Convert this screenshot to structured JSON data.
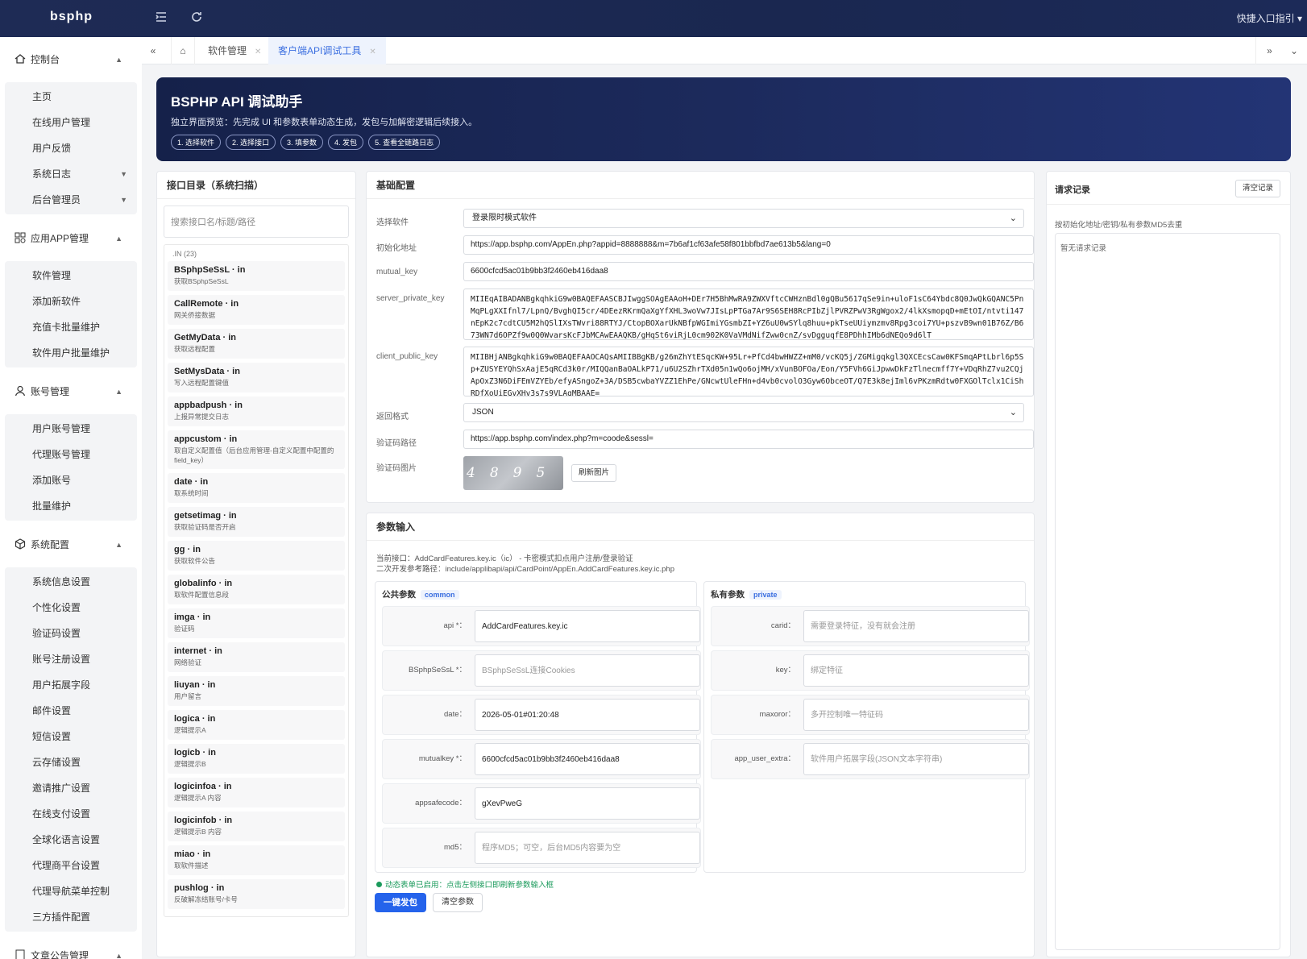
{
  "app": {
    "brand": "bsphp",
    "quick_guide": "快捷入口指引 ▾"
  },
  "sidebar": {
    "groups": [
      {
        "label": "控制台",
        "icon": "home-icon",
        "items": [
          {
            "label": "主页"
          },
          {
            "label": "在线用户管理"
          },
          {
            "label": "用户反馈"
          },
          {
            "label": "系统日志",
            "caret": true
          },
          {
            "label": "后台管理员",
            "caret": true
          }
        ]
      },
      {
        "label": "应用APP管理",
        "icon": "apps-icon",
        "items": [
          {
            "label": "软件管理"
          },
          {
            "label": "添加新软件"
          },
          {
            "label": "充值卡批量维护"
          },
          {
            "label": "软件用户批量维护"
          }
        ]
      },
      {
        "label": "账号管理",
        "icon": "user-icon",
        "items": [
          {
            "label": "用户账号管理"
          },
          {
            "label": "代理账号管理"
          },
          {
            "label": "添加账号"
          },
          {
            "label": "批量维护"
          }
        ]
      },
      {
        "label": "系统配置",
        "icon": "cube-icon",
        "items": [
          {
            "label": "系统信息设置"
          },
          {
            "label": "个性化设置"
          },
          {
            "label": "验证码设置"
          },
          {
            "label": "账号注册设置"
          },
          {
            "label": "用户拓展字段"
          },
          {
            "label": "邮件设置"
          },
          {
            "label": "短信设置"
          },
          {
            "label": "云存储设置"
          },
          {
            "label": "邀请推广设置"
          },
          {
            "label": "在线支付设置"
          },
          {
            "label": "全球化语言设置"
          },
          {
            "label": "代理商平台设置"
          },
          {
            "label": "代理导航菜单控制"
          },
          {
            "label": "三方插件配置"
          }
        ]
      },
      {
        "label": "文章公告管理",
        "icon": "doc-icon",
        "items": []
      }
    ]
  },
  "tabs": [
    {
      "label": "软件管理"
    },
    {
      "label": "客户端API调试工具"
    }
  ],
  "banner": {
    "title": "BSPHP API 调试助手",
    "subtitle": "独立界面预览：先完成 UI 和参数表单动态生成，发包与加解密逻辑后续接入。",
    "steps": [
      "1. 选择软件",
      "2. 选择接口",
      "3. 填参数",
      "4. 发包",
      "5. 查看全链路日志"
    ]
  },
  "directory": {
    "title": "接口目录（系统扫描）",
    "search_placeholder": "搜索接口名/标题/路径",
    "caption": ".IN (23)",
    "items": [
      {
        "name": "BSphpSeSsL · in",
        "desc": "获取BSphpSeSsL"
      },
      {
        "name": "CallRemote · in",
        "desc": "网关侨接数据"
      },
      {
        "name": "GetMyData · in",
        "desc": "获取远程配置"
      },
      {
        "name": "SetMysData · in",
        "desc": "写入远程配置键值"
      },
      {
        "name": "appbadpush · in",
        "desc": "上报异常提交日志"
      },
      {
        "name": "appcustom · in",
        "desc": "取自定义配置值（后台应用管理-自定义配置中配置的field_key）"
      },
      {
        "name": "date · in",
        "desc": "取系统时间"
      },
      {
        "name": "getsetimag · in",
        "desc": "获取验证码是否开启"
      },
      {
        "name": "gg · in",
        "desc": "获取软件公告"
      },
      {
        "name": "globalinfo · in",
        "desc": "取软件配置信息段"
      },
      {
        "name": "imga · in",
        "desc": "验证码"
      },
      {
        "name": "internet · in",
        "desc": "网络验证"
      },
      {
        "name": "liuyan · in",
        "desc": "用户留言"
      },
      {
        "name": "logica · in",
        "desc": "逻辑提示A"
      },
      {
        "name": "logicb · in",
        "desc": "逻辑提示B"
      },
      {
        "name": "logicinfoa · in",
        "desc": "逻辑提示A 内容"
      },
      {
        "name": "logicinfob · in",
        "desc": "逻辑提示B 内容"
      },
      {
        "name": "miao · in",
        "desc": "取软件描述"
      },
      {
        "name": "pushlog · in",
        "desc": "反破解冻结账号/卡号"
      }
    ]
  },
  "basic": {
    "title": "基础配置",
    "software_label": "选择软件",
    "software_value": "登录限时模式软件",
    "init_label": "初始化地址",
    "init_value": "https://app.bsphp.com/AppEn.php?appid=8888888&m=7b6af1cf63afe58f801bbfbd7ae613b5&lang=0",
    "mutual_label": "mutual_key",
    "mutual_value": "6600cfcd5ac01b9bb3f2460eb416daa8",
    "server_key_label": "server_private_key",
    "server_key_value": "MIIEqAIBADANBgkqhkiG9w0BAQEFAASCBJIwggSOAgEAAoH+DEr7H5BhMwRA9ZWXVftcCWHznBdl0gQBu5617qSe9in+uloF1sC64Ybdc8Q0JwQkGQANC5PnMqPLgXXIfnl7/LpnQ/BvghQI5cr/4DEezRKrmQaXgYfXHL3woVw7JIsLpPTGa7Ar9S6SEH8RcPIbZjlPVRZPwV3RgWgox2/4lkXsmopqD+mEtOI/ntvti147nEpK2c7cdtCU5M2hQSlIXsTWvri88RTYJ/CtopBOXarUkNBfpWGImiYGsmbZI+YZ6uU0wSYlq8huu+pkTseUUiymzmv8Rpg3coi7YU+pszvB9wn01B76Z/B673WN7d6OPZf9w0Q0WvarsKcFJbMCAwEAAQKB/gHqSt6viRjL0cm902K0VaVMdNifZww0cnZ/svDgguqfE8PDhhIMb6dNEQo9d6lT",
    "client_key_label": "client_public_key",
    "client_key_value": "MIIBHjANBgkqhkiG9w0BAQEFAAOCAQsAMIIBBgKB/g26mZhYtESqcKW+95Lr+PfCd4bwHWZZ+mM0/vcKQ5j/ZGMigqkgl3QXCEcsCaw0KFSmqAPtLbrl6p5Sp+ZUSYEYQhSxAajE5qRCd3k0r/MIQQanBaOALkP71/u6U2SZhrTXd05n1wQo6ojMH/xVunBOFOa/Eon/Y5FVh6GiJpwwDkFzTlnecmff7Y+VDqRhZ7vu2CQjApOxZ3N6DiFEmVZYEb/efyASngoZ+3A/DSB5cwbaYVZZ1EhPe/GNcwtUleFHn+d4vb0cvolO3Gyw6ObceOT/Q7E3k8ejIml6vPKzmRdtw0FXGOlTclx1CiShRDfXoUiEGvXHv3s7s9VLAgMBAAE=",
    "format_label": "返回格式",
    "format_value": "JSON",
    "captcha_url_label": "验证码路径",
    "captcha_url_value": "https://app.bsphp.com/index.php?m=coode&sessl=",
    "captcha_img_label": "验证码图片",
    "captcha_text": "4895",
    "refresh_label": "刷新图片"
  },
  "params": {
    "title": "参数输入",
    "current": "当前接口：AddCardFeatures.key.ic（ic） - 卡密模式扣点用户注册/登录验证",
    "path": "二次开发参考路径：include/applibapi/api/CardPoint/AppEn.AddCardFeatures.key.ic.php",
    "public_title": "公共参数",
    "public_badge": "common",
    "private_title": "私有参数",
    "private_badge": "private",
    "public_rows": [
      {
        "label": "api *：",
        "value": "AddCardFeatures.key.ic",
        "placeholder": false
      },
      {
        "label": "BSphpSeSsL *：",
        "value": "BSphpSeSsL连接Cookies",
        "placeholder": true
      },
      {
        "label": "date：",
        "value": "2026-05-01#01:20:48",
        "placeholder": false
      },
      {
        "label": "mutualkey *：",
        "value": "6600cfcd5ac01b9bb3f2460eb416daa8",
        "placeholder": false
      },
      {
        "label": "appsafecode：",
        "value": "gXevPweG",
        "placeholder": false
      },
      {
        "label": "md5：",
        "value": "程序MD5；可空，后台MD5内容要为空",
        "placeholder": true
      }
    ],
    "private_rows": [
      {
        "label": "carid：",
        "value": "需要登录特征，没有就会注册",
        "placeholder": true
      },
      {
        "label": "key：",
        "value": "绑定特征",
        "placeholder": true
      },
      {
        "label": "maxoror：",
        "value": "多开控制唯一特征码",
        "placeholder": true
      },
      {
        "label": "app_user_extra：",
        "value": "软件用户拓展字段(JSON文本字符串)",
        "placeholder": true
      }
    ],
    "note": "动态表单已启用：点击左侧接口即刷新参数输入框",
    "send_label": "一键发包",
    "clear_label": "清空参数"
  },
  "log": {
    "title": "请求记录",
    "clear_label": "清空记录",
    "hint": "按初始化地址/密钥/私有参数MD5去重",
    "empty": "暂无请求记录"
  }
}
